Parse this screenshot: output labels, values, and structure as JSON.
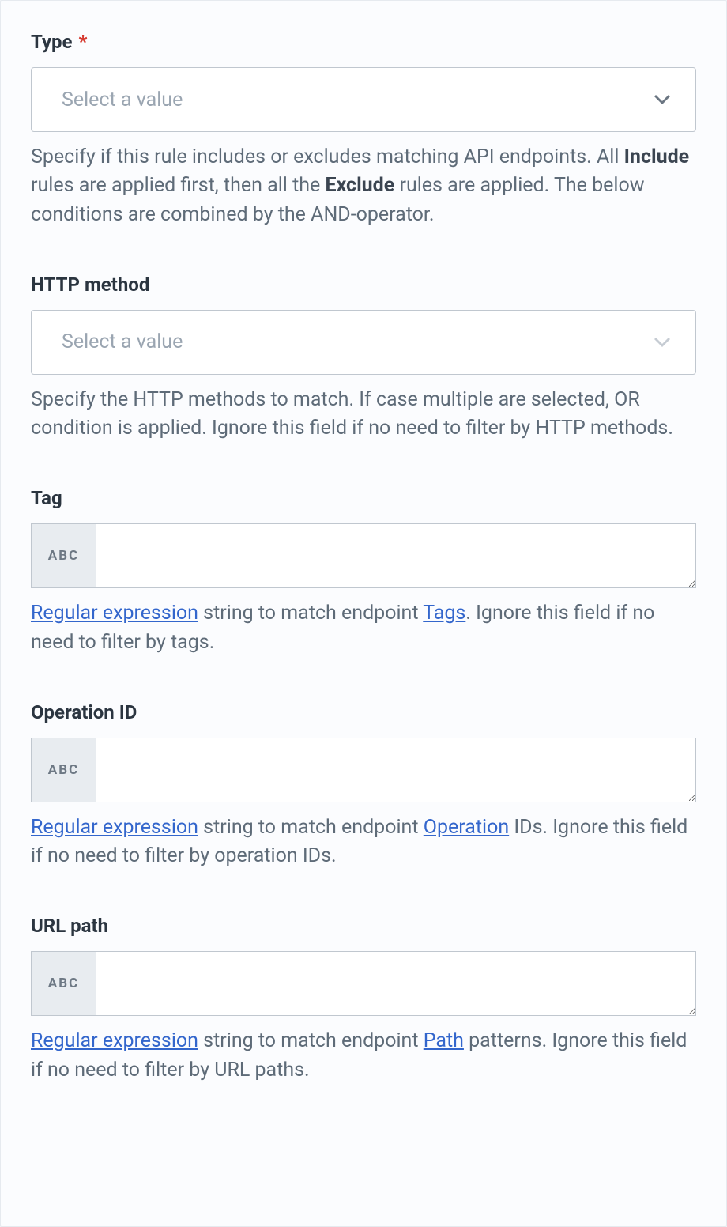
{
  "fields": {
    "type": {
      "label": "Type",
      "placeholder": "Select a value",
      "help_1": "Specify if this rule includes or excludes matching API endpoints. All ",
      "help_strong1": "Include",
      "help_2": " rules are applied first, then all the ",
      "help_strong2": "Exclude",
      "help_3": " rules are applied. The below conditions are combined by the AND-operator."
    },
    "method": {
      "label": "HTTP method",
      "placeholder": "Select a value",
      "help": "Specify the HTTP methods to match. If case multiple are selected, OR condition is applied. Ignore this field if no need to filter by HTTP methods."
    },
    "tag": {
      "label": "Tag",
      "prefix": "ABC",
      "link_regex": "Regular expression",
      "help_1": " string to match endpoint ",
      "link_tags": "Tags",
      "help_2": ". Ignore this field if no need to filter by tags."
    },
    "operation": {
      "label": "Operation ID",
      "prefix": "ABC",
      "link_regex": "Regular expression",
      "help_1": " string to match endpoint ",
      "link_op": "Operation",
      "help_2": " IDs. Ignore this field if no need to filter by operation IDs."
    },
    "path": {
      "label": "URL path",
      "prefix": "ABC",
      "link_regex": "Regular expression",
      "help_1": " string to match endpoint ",
      "link_path": "Path",
      "help_2": " patterns. Ignore this field if no need to filter by URL paths."
    }
  }
}
